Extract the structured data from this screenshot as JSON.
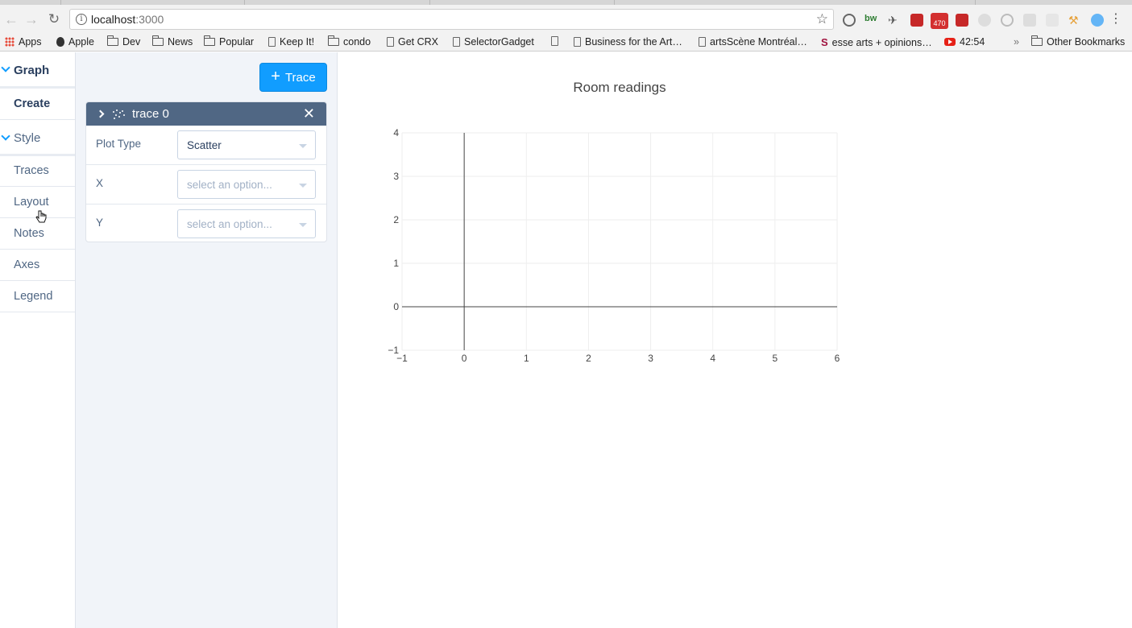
{
  "browser": {
    "url_host": "localhost",
    "url_port": ":3000",
    "bookmarks": [
      {
        "label": "Apps",
        "icon": "apps"
      },
      {
        "label": "Apple",
        "icon": "apple"
      },
      {
        "label": "Dev",
        "icon": "folder"
      },
      {
        "label": "News",
        "icon": "folder"
      },
      {
        "label": "Popular",
        "icon": "folder"
      },
      {
        "label": "Keep It!",
        "icon": "page"
      },
      {
        "label": "condo",
        "icon": "folder"
      },
      {
        "label": "Get CRX",
        "icon": "page"
      },
      {
        "label": "SelectorGadget",
        "icon": "page"
      },
      {
        "label": "",
        "icon": "page"
      },
      {
        "label": "Business for the Art…",
        "icon": "page"
      },
      {
        "label": "artsScène Montréal…",
        "icon": "page"
      },
      {
        "label": "esse arts + opinions…",
        "icon": "s"
      },
      {
        "label": "42:54",
        "icon": "yt"
      },
      {
        "label": "Other Bookmarks",
        "icon": "folder"
      }
    ],
    "overflow_label": "»",
    "ext_badge": "470"
  },
  "sidebar": {
    "graph_label": "Graph",
    "create_label": "Create",
    "style_label": "Style",
    "items": [
      "Traces",
      "Layout",
      "Notes",
      "Axes",
      "Legend"
    ]
  },
  "panel": {
    "add_trace_label": "Trace",
    "trace": {
      "name": "trace 0",
      "fields": [
        {
          "label": "Plot Type",
          "value": "Scatter",
          "placeholder": false
        },
        {
          "label": "X",
          "value": "select an option...",
          "placeholder": true
        },
        {
          "label": "Y",
          "value": "select an option...",
          "placeholder": true
        }
      ]
    }
  },
  "chart_data": {
    "type": "scatter",
    "title": "Room readings",
    "xlabel": "",
    "ylabel": "",
    "xlim": [
      -1,
      6
    ],
    "ylim": [
      -1,
      4
    ],
    "x_ticks": [
      "−1",
      "0",
      "1",
      "2",
      "3",
      "4",
      "5",
      "6"
    ],
    "y_ticks": [
      "−1",
      "0",
      "1",
      "2",
      "3",
      "4"
    ],
    "series": [],
    "grid": true
  },
  "colors": {
    "accent": "#119dff",
    "panel_header": "#506784",
    "panel_bg": "#f1f4f9",
    "text": "#2a3f5f"
  }
}
